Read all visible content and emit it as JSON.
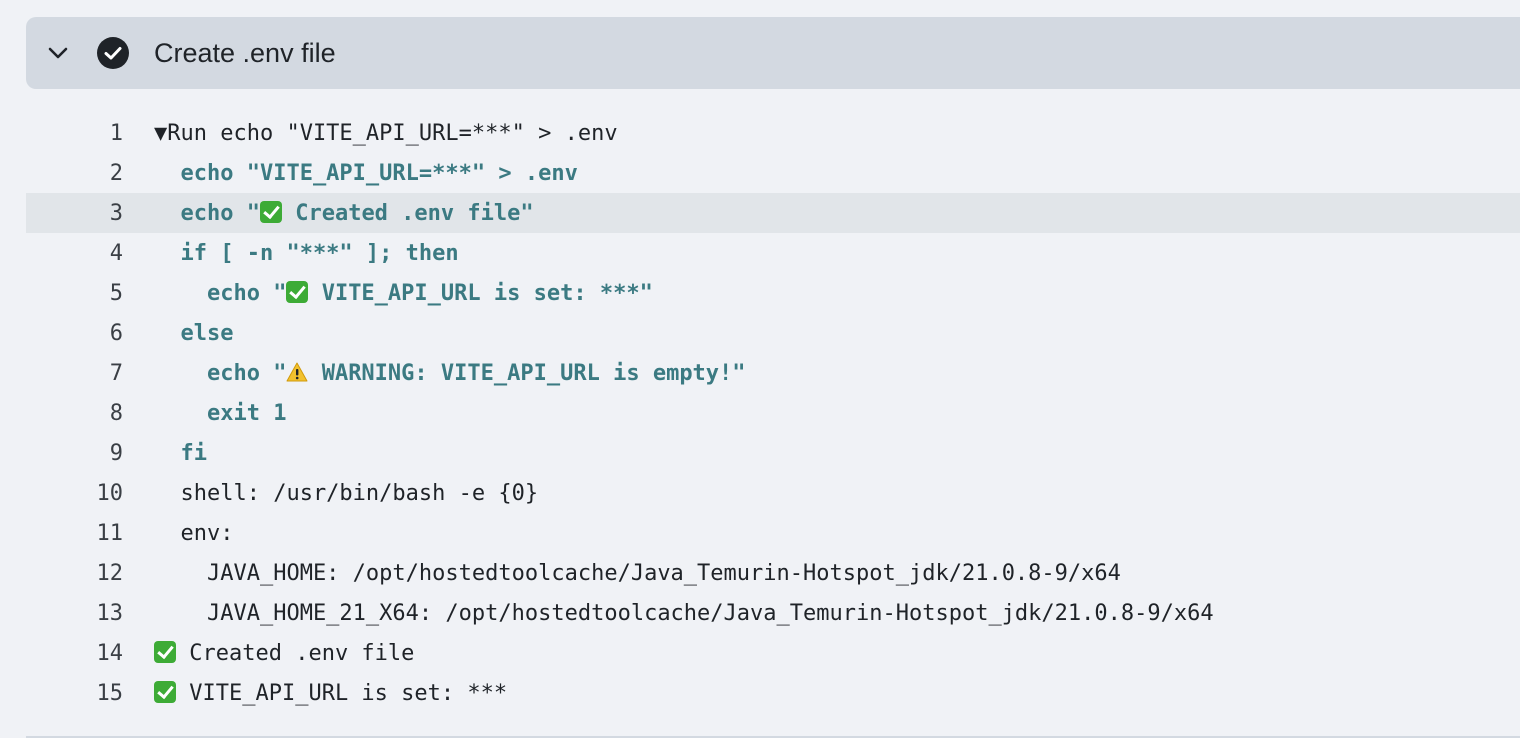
{
  "step": {
    "title": "Create .env file",
    "status": "success"
  },
  "log": {
    "lines": [
      {
        "num": "1",
        "parts": [
          {
            "t": "▼Run echo \"VITE_API_URL=***\" > .env"
          }
        ]
      },
      {
        "num": "2",
        "parts": [
          {
            "t": "  echo \"VITE_API_URL=***\" > .env",
            "cmd": true
          }
        ]
      },
      {
        "num": "3",
        "highlight": true,
        "parts": [
          {
            "t": "  echo \"",
            "cmd": true
          },
          {
            "icon": "check-mark-icon"
          },
          {
            "t": " Created .env file\"",
            "cmd": true
          }
        ]
      },
      {
        "num": "4",
        "parts": [
          {
            "t": "  if [ -n \"***\" ]; then",
            "cmd": true
          }
        ]
      },
      {
        "num": "5",
        "parts": [
          {
            "t": "    echo \"",
            "cmd": true
          },
          {
            "icon": "check-mark-icon"
          },
          {
            "t": " VITE_API_URL is set: ***\"",
            "cmd": true
          }
        ]
      },
      {
        "num": "6",
        "parts": [
          {
            "t": "  else",
            "cmd": true
          }
        ]
      },
      {
        "num": "7",
        "parts": [
          {
            "t": "    echo \"",
            "cmd": true
          },
          {
            "icon": "warning-icon"
          },
          {
            "t": " WARNING: VITE_API_URL is empty!\"",
            "cmd": true
          }
        ]
      },
      {
        "num": "8",
        "parts": [
          {
            "t": "    exit 1",
            "cmd": true
          }
        ]
      },
      {
        "num": "9",
        "parts": [
          {
            "t": "  fi",
            "cmd": true
          }
        ]
      },
      {
        "num": "10",
        "parts": [
          {
            "t": "  shell: /usr/bin/bash -e {0}"
          }
        ]
      },
      {
        "num": "11",
        "parts": [
          {
            "t": "  env:"
          }
        ]
      },
      {
        "num": "12",
        "parts": [
          {
            "t": "    JAVA_HOME: /opt/hostedtoolcache/Java_Temurin-Hotspot_jdk/21.0.8-9/x64"
          }
        ]
      },
      {
        "num": "13",
        "parts": [
          {
            "t": "    JAVA_HOME_21_X64: /opt/hostedtoolcache/Java_Temurin-Hotspot_jdk/21.0.8-9/x64"
          }
        ]
      },
      {
        "num": "14",
        "parts": [
          {
            "icon": "check-mark-icon"
          },
          {
            "t": " Created .env file"
          }
        ]
      },
      {
        "num": "15",
        "parts": [
          {
            "icon": "check-mark-icon"
          },
          {
            "t": " VITE_API_URL is set: ***"
          }
        ]
      }
    ]
  }
}
